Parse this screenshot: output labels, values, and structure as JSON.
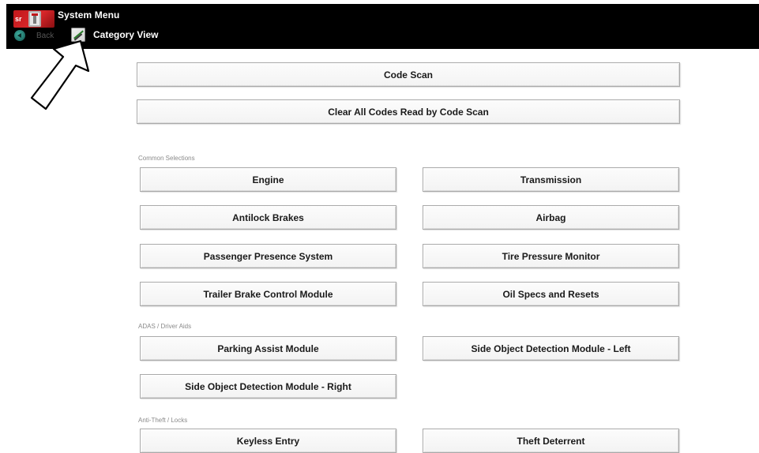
{
  "header": {
    "title": "System Menu",
    "back_label": "Back",
    "category_label": "Category View",
    "logo_icon": "red-logo-icon",
    "back_icon": "back-arrow-icon",
    "category_icon": "category-view-icon"
  },
  "top_actions": [
    {
      "label": "Code Scan"
    },
    {
      "label": "Clear All Codes Read by Code Scan"
    }
  ],
  "sections": {
    "common": {
      "title": "Common Selections",
      "items": [
        "Engine",
        "Transmission",
        "Antilock Brakes",
        "Airbag",
        "Passenger Presence System",
        "Tire Pressure Monitor",
        "Trailer Brake Control Module",
        "Oil Specs and Resets"
      ]
    },
    "adas": {
      "title": "ADAS / Driver Aids",
      "items": [
        "Parking Assist Module",
        "Side Object Detection Module - Left",
        "Side Object Detection Module - Right"
      ]
    },
    "antitheft": {
      "title": "Anti-Theft / Locks",
      "items": [
        "Keyless Entry",
        "Theft Deterrent"
      ]
    }
  },
  "colors": {
    "toolbar_bg": "#000000",
    "button_border": "#a9a9a9",
    "section_label": "#8a8a8a"
  }
}
